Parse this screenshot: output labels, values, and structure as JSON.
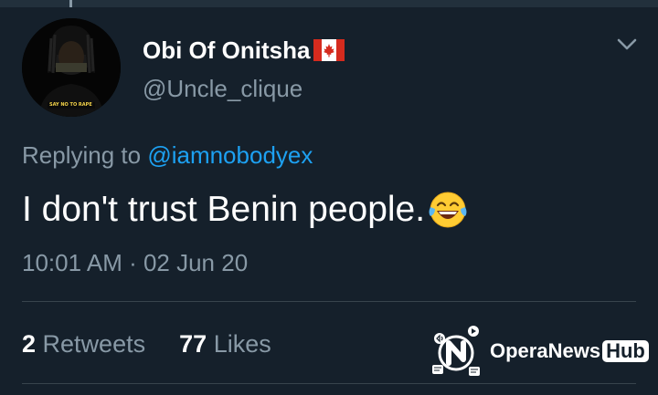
{
  "tweet": {
    "author_name": "Obi Of Onitsha",
    "author_flag": "canada-flag",
    "author_handle": "@Uncle_clique",
    "avatar_caption": "SAY NO TO RAPE",
    "replying_prefix": "Replying to",
    "replying_to": "@iamnobodyex",
    "text": "I don't trust Benin people.",
    "emoji": "face-with-tears-of-joy",
    "timestamp": "10:01 AM · 02 Jun 20",
    "retweets_count": "2",
    "retweets_label": "Retweets",
    "likes_count": "77",
    "likes_label": "Likes"
  },
  "watermark": {
    "brand": "OperaNews",
    "brand_suffix": "Hub"
  },
  "colors": {
    "background": "#15202b",
    "secondary_text": "#8899a6",
    "link": "#1da1f2",
    "divider": "#38444d"
  }
}
